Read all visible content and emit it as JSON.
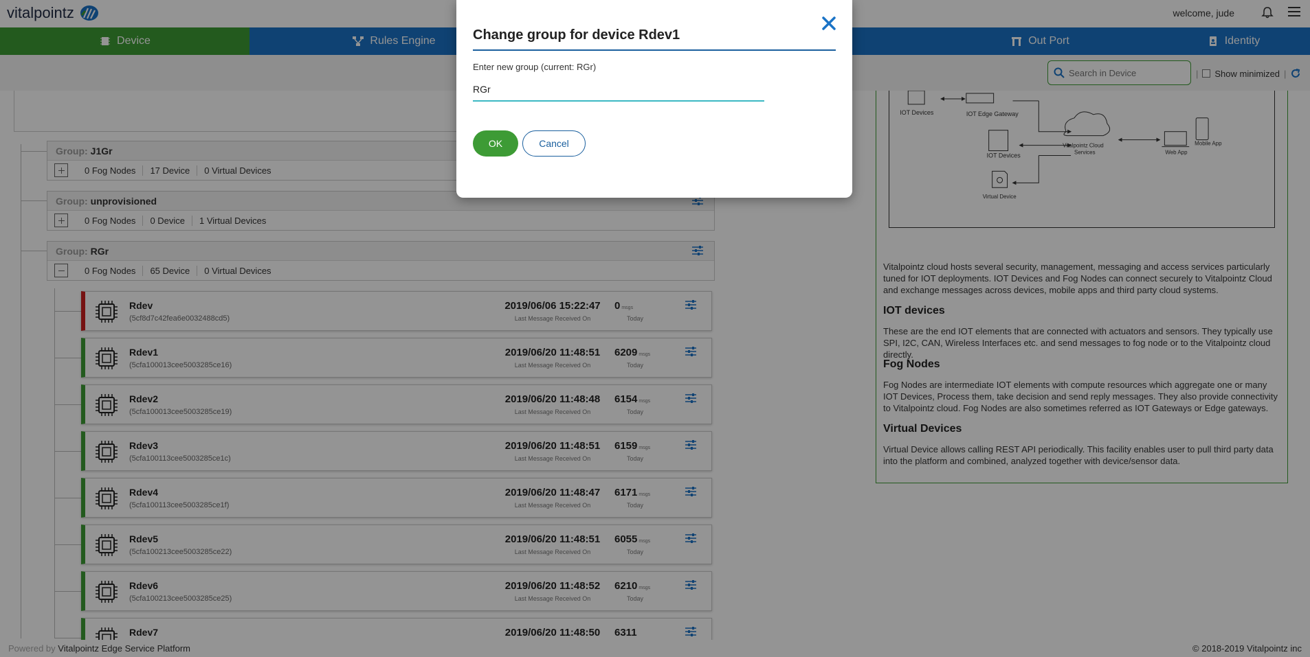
{
  "app": {
    "logo_text": "vitalpointz",
    "welcome": "welcome, jude"
  },
  "nav": {
    "tabs": [
      {
        "label": "Device",
        "icon": "chip-icon",
        "active": true
      },
      {
        "label": "Rules Engine",
        "icon": "network-icon"
      },
      {
        "label": "Out Port",
        "icon": "building-icon"
      },
      {
        "label": "Identity",
        "icon": "id-badge-icon"
      }
    ]
  },
  "toolbar": {
    "search_placeholder": "Search in Device",
    "show_minimized": "Show minimized"
  },
  "groups": [
    {
      "label": "Group:",
      "name": "J1Gr",
      "fog_nodes": "0 Fog Nodes",
      "devices": "17 Device",
      "virtual": "0 Virtual Devices",
      "expanded": false
    },
    {
      "label": "Group:",
      "name": "unprovisioned",
      "fog_nodes": "0 Fog Nodes",
      "devices": "0 Device",
      "virtual": "1 Virtual Devices",
      "expanded": false
    },
    {
      "label": "Group:",
      "name": "RGr",
      "fog_nodes": "0 Fog Nodes",
      "devices": "65 Device",
      "virtual": "0 Virtual Devices",
      "expanded": true
    }
  ],
  "devices": [
    {
      "name": "Rdev",
      "id": "(5cf8d7c42fea6e0032488cd5)",
      "time": "2019/06/06 15:22:47",
      "time_label": "Last Message Received On",
      "count": "0",
      "unit": "msgs",
      "count_label": "Today",
      "status": "inactive"
    },
    {
      "name": "Rdev1",
      "id": "(5cfa100013cee5003285ce16)",
      "time": "2019/06/20 11:48:51",
      "time_label": "Last Message Received On",
      "count": "6209",
      "unit": "msgs",
      "count_label": "Today",
      "status": "active"
    },
    {
      "name": "Rdev2",
      "id": "(5cfa100013cee5003285ce19)",
      "time": "2019/06/20 11:48:48",
      "time_label": "Last Message Received On",
      "count": "6154",
      "unit": "msgs",
      "count_label": "Today",
      "status": "active"
    },
    {
      "name": "Rdev3",
      "id": "(5cfa100113cee5003285ce1c)",
      "time": "2019/06/20 11:48:51",
      "time_label": "Last Message Received On",
      "count": "6159",
      "unit": "msgs",
      "count_label": "Today",
      "status": "active"
    },
    {
      "name": "Rdev4",
      "id": "(5cfa100113cee5003285ce1f)",
      "time": "2019/06/20 11:48:47",
      "time_label": "Last Message Received On",
      "count": "6171",
      "unit": "msgs",
      "count_label": "Today",
      "status": "active"
    },
    {
      "name": "Rdev5",
      "id": "(5cfa100213cee5003285ce22)",
      "time": "2019/06/20 11:48:51",
      "time_label": "Last Message Received On",
      "count": "6055",
      "unit": "msgs",
      "count_label": "Today",
      "status": "active"
    },
    {
      "name": "Rdev6",
      "id": "(5cfa100213cee5003285ce25)",
      "time": "2019/06/20 11:48:52",
      "time_label": "Last Message Received On",
      "count": "6210",
      "unit": "msgs",
      "count_label": "Today",
      "status": "active"
    },
    {
      "name": "Rdev7",
      "id": "",
      "time": "2019/06/20 11:48:50",
      "time_label": "",
      "count": "6311",
      "unit": "",
      "count_label": "",
      "status": "active"
    }
  ],
  "info": {
    "diagram": {
      "iot_devices": "IOT Devices",
      "edge_gateway": "IOT Edge Gateway",
      "cloud": "Vitalpointz Cloud",
      "cloud2": "Services",
      "web_app": "Web App",
      "mobile_app": "Mobile App",
      "virtual_device": "Virtual Device"
    },
    "intro": "Vitalpointz cloud hosts several security, management, messaging and access services particularly tuned for IOT deployments. IOT Devices and Fog Nodes can connect securely to Vitalpointz Cloud and exchange messages across devices, mobile apps and third party cloud systems.",
    "iot_title": "IOT devices",
    "iot_text": "These are the end IOT elements that are connected with actuators and sensors. They typically use SPI, I2C, CAN, Wireless Interfaces etc. and send messages to fog node or to the Vitalpointz cloud directly.",
    "fog_title": "Fog Nodes",
    "fog_text": "Fog Nodes are intermediate IOT elements with compute resources which aggregate one or many IOT Devices, Process them, take decision and send reply messages. They also provide connectivity to Vitalpointz cloud. Fog Nodes are also sometimes referred as IOT Gateways or Edge gateways.",
    "virtual_title": "Virtual Devices",
    "virtual_text": "Virtual Device allows calling REST API periodically. This facility enables user to pull third party data into the platform and combined, analyzed together with device/sensor data."
  },
  "footer": {
    "powered_by": "Powered by",
    "platform": "Vitalpointz Edge Service Platform",
    "copyright": "© 2018-2019 Vitalpointz inc"
  },
  "modal": {
    "title": "Change group for device Rdev1",
    "label": "Enter new group (current: RGr)",
    "input_value": "RGr",
    "ok": "OK",
    "cancel": "Cancel"
  },
  "colors": {
    "green": "#3d9b35",
    "blue": "#1a73c6",
    "red": "#cc1f1f",
    "teal": "#3bb8c3"
  }
}
